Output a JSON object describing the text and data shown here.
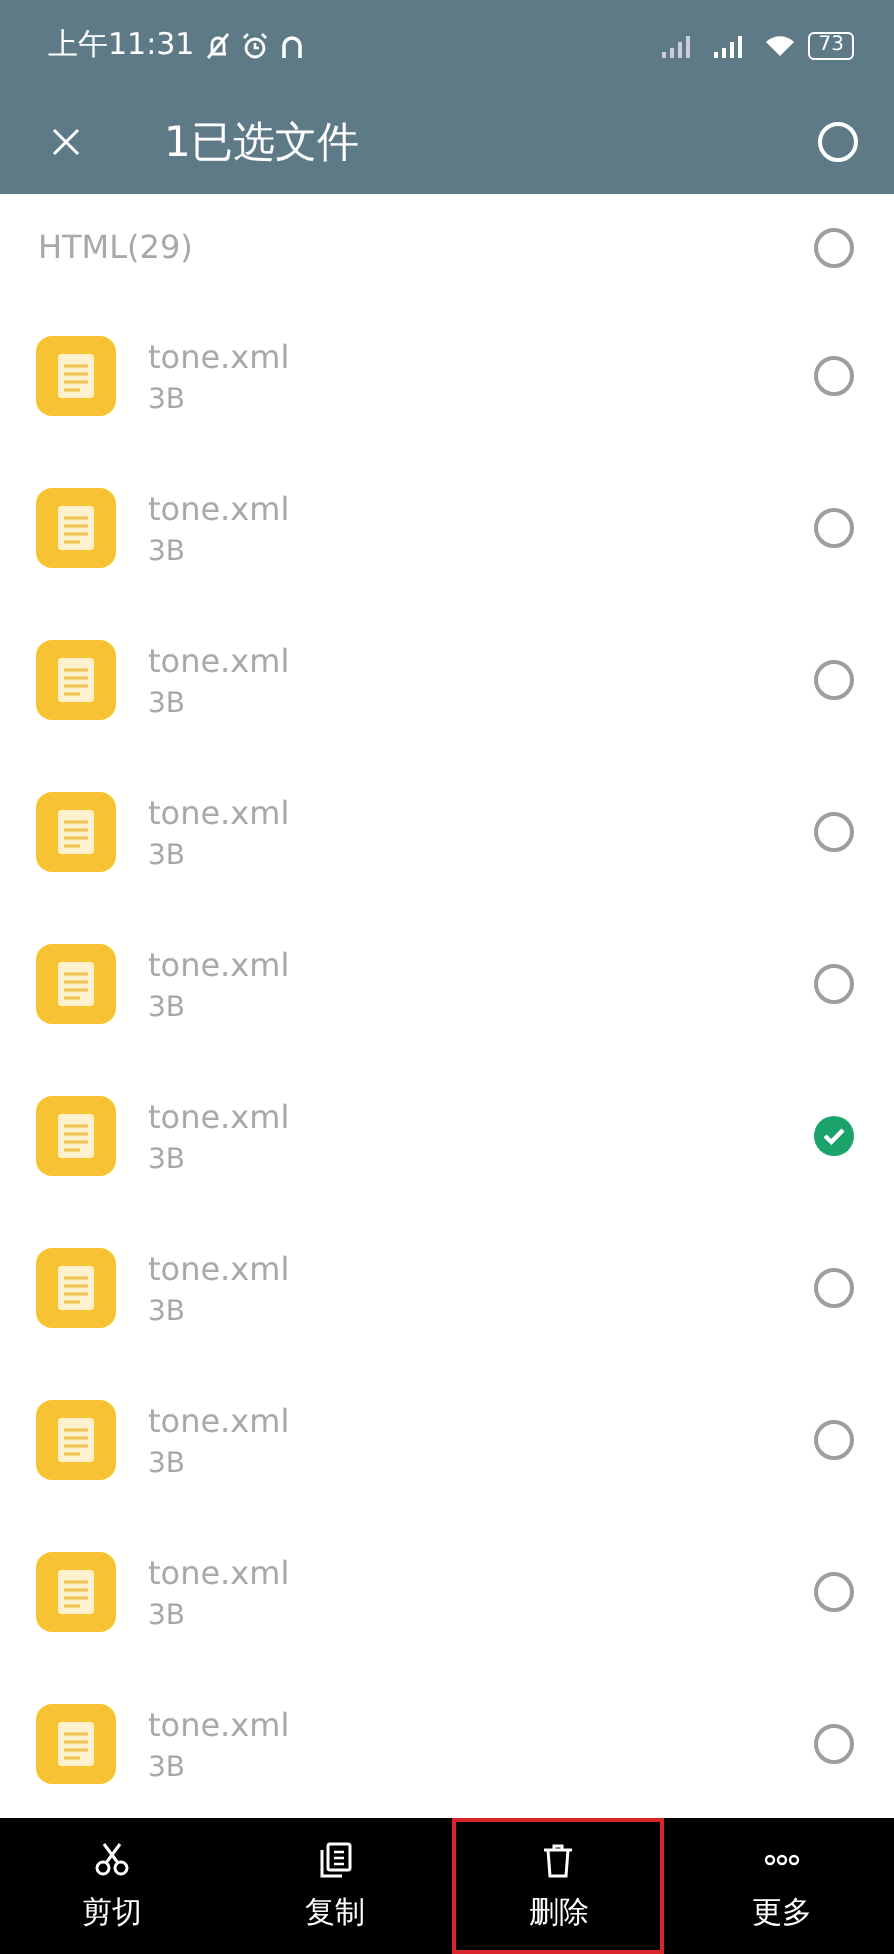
{
  "status_bar": {
    "time": "上午11:31",
    "battery": "73"
  },
  "header": {
    "title": "1已选文件",
    "all_selected": false
  },
  "group": {
    "label": "HTML(29)",
    "selected": false
  },
  "files": [
    {
      "name": "tone.xml",
      "size": "3B",
      "selected": false
    },
    {
      "name": "tone.xml",
      "size": "3B",
      "selected": false
    },
    {
      "name": "tone.xml",
      "size": "3B",
      "selected": false
    },
    {
      "name": "tone.xml",
      "size": "3B",
      "selected": false
    },
    {
      "name": "tone.xml",
      "size": "3B",
      "selected": false
    },
    {
      "name": "tone.xml",
      "size": "3B",
      "selected": true
    },
    {
      "name": "tone.xml",
      "size": "3B",
      "selected": false
    },
    {
      "name": "tone.xml",
      "size": "3B",
      "selected": false
    },
    {
      "name": "tone.xml",
      "size": "3B",
      "selected": false
    },
    {
      "name": "tone.xml",
      "size": "3B",
      "selected": false
    }
  ],
  "actions": [
    {
      "kind": "cut",
      "label": "剪切",
      "highlighted": false
    },
    {
      "kind": "copy",
      "label": "复制",
      "highlighted": false
    },
    {
      "kind": "delete",
      "label": "删除",
      "highlighted": true
    },
    {
      "kind": "more",
      "label": "更多",
      "highlighted": false
    }
  ]
}
